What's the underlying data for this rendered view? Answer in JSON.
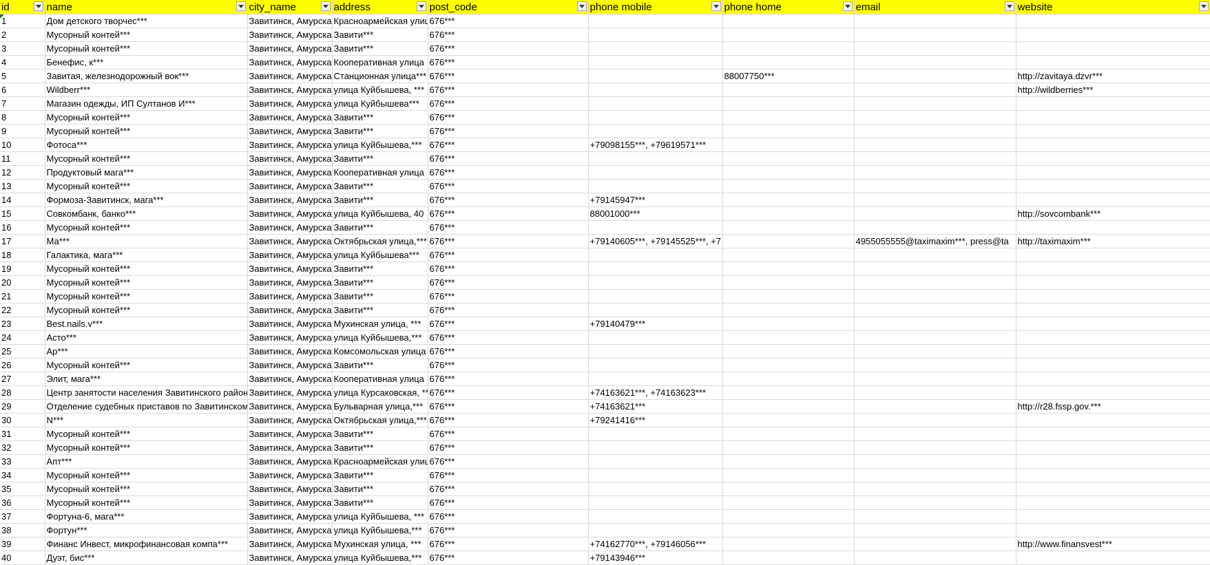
{
  "columns": [
    {
      "key": "id",
      "label": "id"
    },
    {
      "key": "name",
      "label": "name"
    },
    {
      "key": "city_name",
      "label": "city_name"
    },
    {
      "key": "address",
      "label": "address"
    },
    {
      "key": "post_code",
      "label": "post_code"
    },
    {
      "key": "phone_mobile",
      "label": "phone mobile"
    },
    {
      "key": "phone_home",
      "label": "phone home"
    },
    {
      "key": "email",
      "label": "email"
    },
    {
      "key": "website",
      "label": "website"
    }
  ],
  "rows": [
    [
      "1",
      "Дом детского творчес***",
      "Завитинск, Амурская",
      "Красноармейская улица",
      "676***",
      "",
      "",
      "",
      ""
    ],
    [
      "2",
      "Мусорный контей***",
      "Завитинск, Амурская",
      "Завити***",
      "676***",
      "",
      "",
      "",
      ""
    ],
    [
      "3",
      "Мусорный контей***",
      "Завитинск, Амурская",
      "Завити***",
      "676***",
      "",
      "",
      "",
      ""
    ],
    [
      "4",
      "Бенефис, к***",
      "Завитинск, Амурская",
      "Кооперативная улица",
      "676***",
      "",
      "",
      "",
      ""
    ],
    [
      "5",
      "Завитая, железнодорожный вок***",
      "Завитинск, Амурская",
      "Станционная улица***",
      "676***",
      "",
      "88007750***",
      "",
      "http://zavitaya.dzvr***"
    ],
    [
      "6",
      "Wildberr***",
      "Завитинск, Амурская",
      "улица Куйбышева, ***",
      "676***",
      "",
      "",
      "",
      "http://wildberries***"
    ],
    [
      "7",
      "Магазин одежды, ИП Султанов И***",
      "Завитинск, Амурская",
      "улица Куйбышева***",
      "676***",
      "",
      "",
      "",
      ""
    ],
    [
      "8",
      "Мусорный контей***",
      "Завитинск, Амурская",
      "Завити***",
      "676***",
      "",
      "",
      "",
      ""
    ],
    [
      "9",
      "Мусорный контей***",
      "Завитинск, Амурская",
      "Завити***",
      "676***",
      "",
      "",
      "",
      ""
    ],
    [
      "10",
      "Фотоса***",
      "Завитинск, Амурская",
      "улица Куйбышева,***",
      "676***",
      "+79098155***, +79619571***",
      "",
      "",
      ""
    ],
    [
      "11",
      "Мусорный контей***",
      "Завитинск, Амурская",
      "Завити***",
      "676***",
      "",
      "",
      "",
      ""
    ],
    [
      "12",
      "Продуктовый мага***",
      "Завитинск, Амурская",
      "Кооперативная улица",
      "676***",
      "",
      "",
      "",
      ""
    ],
    [
      "13",
      "Мусорный контей***",
      "Завитинск, Амурская",
      "Завити***",
      "676***",
      "",
      "",
      "",
      ""
    ],
    [
      "14",
      "Формоза-Завитинск, мага***",
      "Завитинск, Амурская",
      "Завити***",
      "676***",
      "+79145947***",
      "",
      "",
      ""
    ],
    [
      "15",
      "Совкомбанк, банко***",
      "Завитинск, Амурская",
      "улица Куйбышева, 40",
      "676***",
      "88001000***",
      "",
      "",
      "http://sovcombank***"
    ],
    [
      "16",
      "Мусорный контей***",
      "Завитинск, Амурская",
      "Завити***",
      "676***",
      "",
      "",
      "",
      ""
    ],
    [
      "17",
      "Ма***",
      "Завитинск, Амурская",
      "Октябрьская улица,***",
      "676***",
      "+79140605***, +79145525***, +7",
      "",
      "4955055555@taximaxim***, press@ta",
      "http://taximaxim***"
    ],
    [
      "18",
      "Галактика, мага***",
      "Завитинск, Амурская",
      "улица Куйбышева***",
      "676***",
      "",
      "",
      "",
      ""
    ],
    [
      "19",
      "Мусорный контей***",
      "Завитинск, Амурская",
      "Завити***",
      "676***",
      "",
      "",
      "",
      ""
    ],
    [
      "20",
      "Мусорный контей***",
      "Завитинск, Амурская",
      "Завити***",
      "676***",
      "",
      "",
      "",
      ""
    ],
    [
      "21",
      "Мусорный контей***",
      "Завитинск, Амурская",
      "Завити***",
      "676***",
      "",
      "",
      "",
      ""
    ],
    [
      "22",
      "Мусорный контей***",
      "Завитинск, Амурская",
      "Завити***",
      "676***",
      "",
      "",
      "",
      ""
    ],
    [
      "23",
      "Best.nails.v***",
      "Завитинск, Амурская",
      "Мухинская улица, ***",
      "676***",
      "+79140479***",
      "",
      "",
      ""
    ],
    [
      "24",
      "Асто***",
      "Завитинск, Амурская",
      "улица Куйбышева,***",
      "676***",
      "",
      "",
      "",
      ""
    ],
    [
      "25",
      "Ар***",
      "Завитинск, Амурская",
      "Комсомольская улица",
      "676***",
      "",
      "",
      "",
      ""
    ],
    [
      "26",
      "Мусорный контей***",
      "Завитинск, Амурская",
      "Завити***",
      "676***",
      "",
      "",
      "",
      ""
    ],
    [
      "27",
      "Элит, мага***",
      "Завитинск, Амурская",
      "Кооперативная улица",
      "676***",
      "",
      "",
      "",
      ""
    ],
    [
      "28",
      "Центр занятости населения Завитинского района",
      "Завитинск, Амурская",
      "улица Курсаковская, ***",
      "676***",
      "+74163621***, +74163623***",
      "",
      "",
      ""
    ],
    [
      "29",
      "Отделение судебных приставов по Завитинскому",
      "Завитинск, Амурская",
      "Бульварная улица,***",
      "676***",
      "+74163621***",
      "",
      "",
      "http://r28.fssp.gov.***"
    ],
    [
      "30",
      "N***",
      "Завитинск, Амурская",
      "Октябрьская улица,***",
      "676***",
      "+79241416***",
      "",
      "",
      ""
    ],
    [
      "31",
      "Мусорный контей***",
      "Завитинск, Амурская",
      "Завити***",
      "676***",
      "",
      "",
      "",
      ""
    ],
    [
      "32",
      "Мусорный контей***",
      "Завитинск, Амурская",
      "Завити***",
      "676***",
      "",
      "",
      "",
      ""
    ],
    [
      "33",
      "Апт***",
      "Завитинск, Амурская",
      "Красноармейская улица",
      "676***",
      "",
      "",
      "",
      ""
    ],
    [
      "34",
      "Мусорный контей***",
      "Завитинск, Амурская",
      "Завити***",
      "676***",
      "",
      "",
      "",
      ""
    ],
    [
      "35",
      "Мусорный контей***",
      "Завитинск, Амурская",
      "Завити***",
      "676***",
      "",
      "",
      "",
      ""
    ],
    [
      "36",
      "Мусорный контей***",
      "Завитинск, Амурская",
      "Завити***",
      "676***",
      "",
      "",
      "",
      ""
    ],
    [
      "37",
      "Фортуна-6, мага***",
      "Завитинск, Амурская",
      "улица Куйбышева, ***",
      "676***",
      "",
      "",
      "",
      ""
    ],
    [
      "38",
      "Фортун***",
      "Завитинск, Амурская",
      "улица Куйбышева,***",
      "676***",
      "",
      "",
      "",
      ""
    ],
    [
      "39",
      "Финанс Инвест, микрофинансовая компа***",
      "Завитинск, Амурская",
      "Мухинская улица, ***",
      "676***",
      "+74162770***, +79146056***",
      "",
      "",
      "http://www.finansvest***"
    ],
    [
      "40",
      "Дуэт, бис***",
      "Завитинск, Амурская",
      "улица Куйбышева,***",
      "676***",
      "+79143946***",
      "",
      "",
      ""
    ]
  ]
}
